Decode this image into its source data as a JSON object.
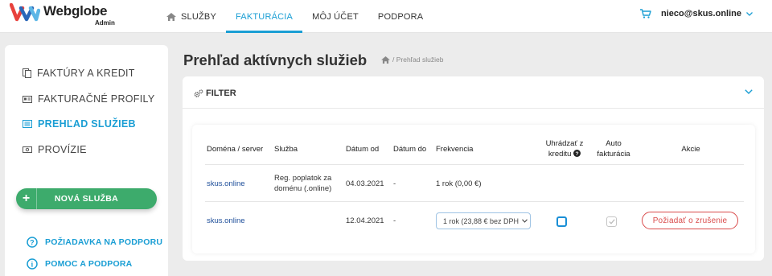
{
  "brand": {
    "name": "Webglobe",
    "sub": "Admin"
  },
  "nav": {
    "items": [
      {
        "label": "SLUŽBY",
        "icon": "home-icon"
      },
      {
        "label": "FAKTURÁCIA",
        "active": true
      },
      {
        "label": "MÔJ ÚČET"
      },
      {
        "label": "PODPORA"
      }
    ]
  },
  "user": {
    "email": "nieco@skus.online",
    "cart_icon": "cart-icon"
  },
  "sidebar": {
    "items": [
      {
        "label": "FAKTÚRY A KREDIT",
        "icon": "documents-icon"
      },
      {
        "label": "FAKTURAČNÉ PROFILY",
        "icon": "id-card-icon"
      },
      {
        "label": "PREHĽAD SLUŽIEB",
        "icon": "list-icon",
        "active": true
      },
      {
        "label": "PROVÍZIE",
        "icon": "money-icon"
      }
    ],
    "new_service": "NOVÁ SLUŽBA",
    "links": [
      {
        "label": "POŽIADAVKA NA PODPORU",
        "icon": "question-circle-icon"
      },
      {
        "label": "POMOC A PODPORA",
        "icon": "info-circle-icon"
      }
    ]
  },
  "page": {
    "title": "Prehľad aktívnych služieb",
    "breadcrumb": "/ Prehľad služieb"
  },
  "filter": {
    "label": "FILTER"
  },
  "table": {
    "headers": {
      "domain": "Doména / server",
      "service": "Služba",
      "date_from": "Dátum od",
      "date_to": "Dátum do",
      "frequency": "Frekvencia",
      "credit_line1": "Uhrádzať z",
      "credit_line2": "kreditu",
      "auto_line1": "Auto",
      "auto_line2": "fakturácia",
      "actions": "Akcie"
    },
    "rows": [
      {
        "domain": "skus.online",
        "service_line1": "Reg. poplatok za",
        "service_line2": "doménu (.online)",
        "date_from": "04.03.2021",
        "date_to": "-",
        "frequency": "1 rok (0,00 €)"
      },
      {
        "domain": "skus.online",
        "service_line1": "",
        "service_line2": "",
        "date_from": "12.04.2021",
        "date_to": "-",
        "frequency": "1 rok (23,88 € bez DPH)",
        "credit_checked": false,
        "auto_checked": true,
        "action": "Požiadať o zrušenie"
      }
    ]
  },
  "colors": {
    "accent": "#1a9ed4",
    "green": "#3dab6c",
    "danger": "#d94a4a"
  }
}
